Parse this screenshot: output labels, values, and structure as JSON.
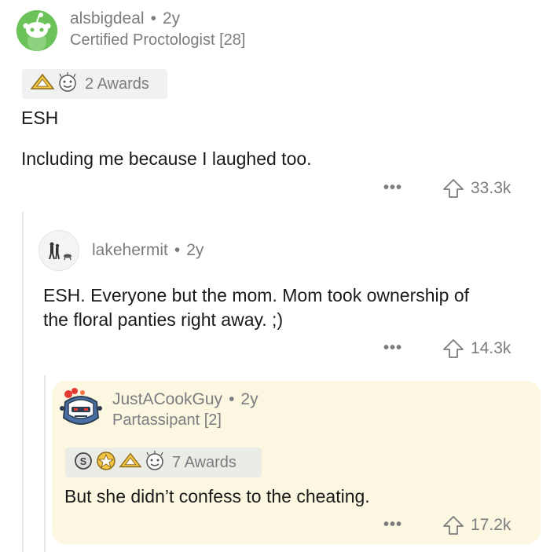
{
  "comments": [
    {
      "username": "alsbigdeal",
      "age": "2y",
      "flair": "Certified Proctologist [28]",
      "awards_label": "2 Awards",
      "body_lines": [
        "ESH",
        "Including me because I laughed too."
      ],
      "votes": "33.3k",
      "avatar_icon": "reddit-snoo-green-icon"
    },
    {
      "username": "lakehermit",
      "age": "2y",
      "body_lines": [
        "ESH. Everyone but the mom. Mom took ownership of",
        "the floral panties right away. ;)"
      ],
      "votes": "14.3k",
      "avatar_icon": "silhouette-walkers-avatar"
    },
    {
      "username": "JustACookGuy",
      "age": "2y",
      "flair": "Partassipant [2]",
      "awards_label": "7 Awards",
      "body_lines": [
        "But she didn’t confess to the cheating."
      ],
      "votes": "17.2k",
      "avatar_icon": "snoo-robot-avatar"
    }
  ],
  "ui": {
    "separator": "•",
    "more": "•••"
  },
  "colors": {
    "highlight_bg": "#fcf7e1",
    "muted_text": "#7c7c80",
    "snoo_green": "#6ac259"
  }
}
